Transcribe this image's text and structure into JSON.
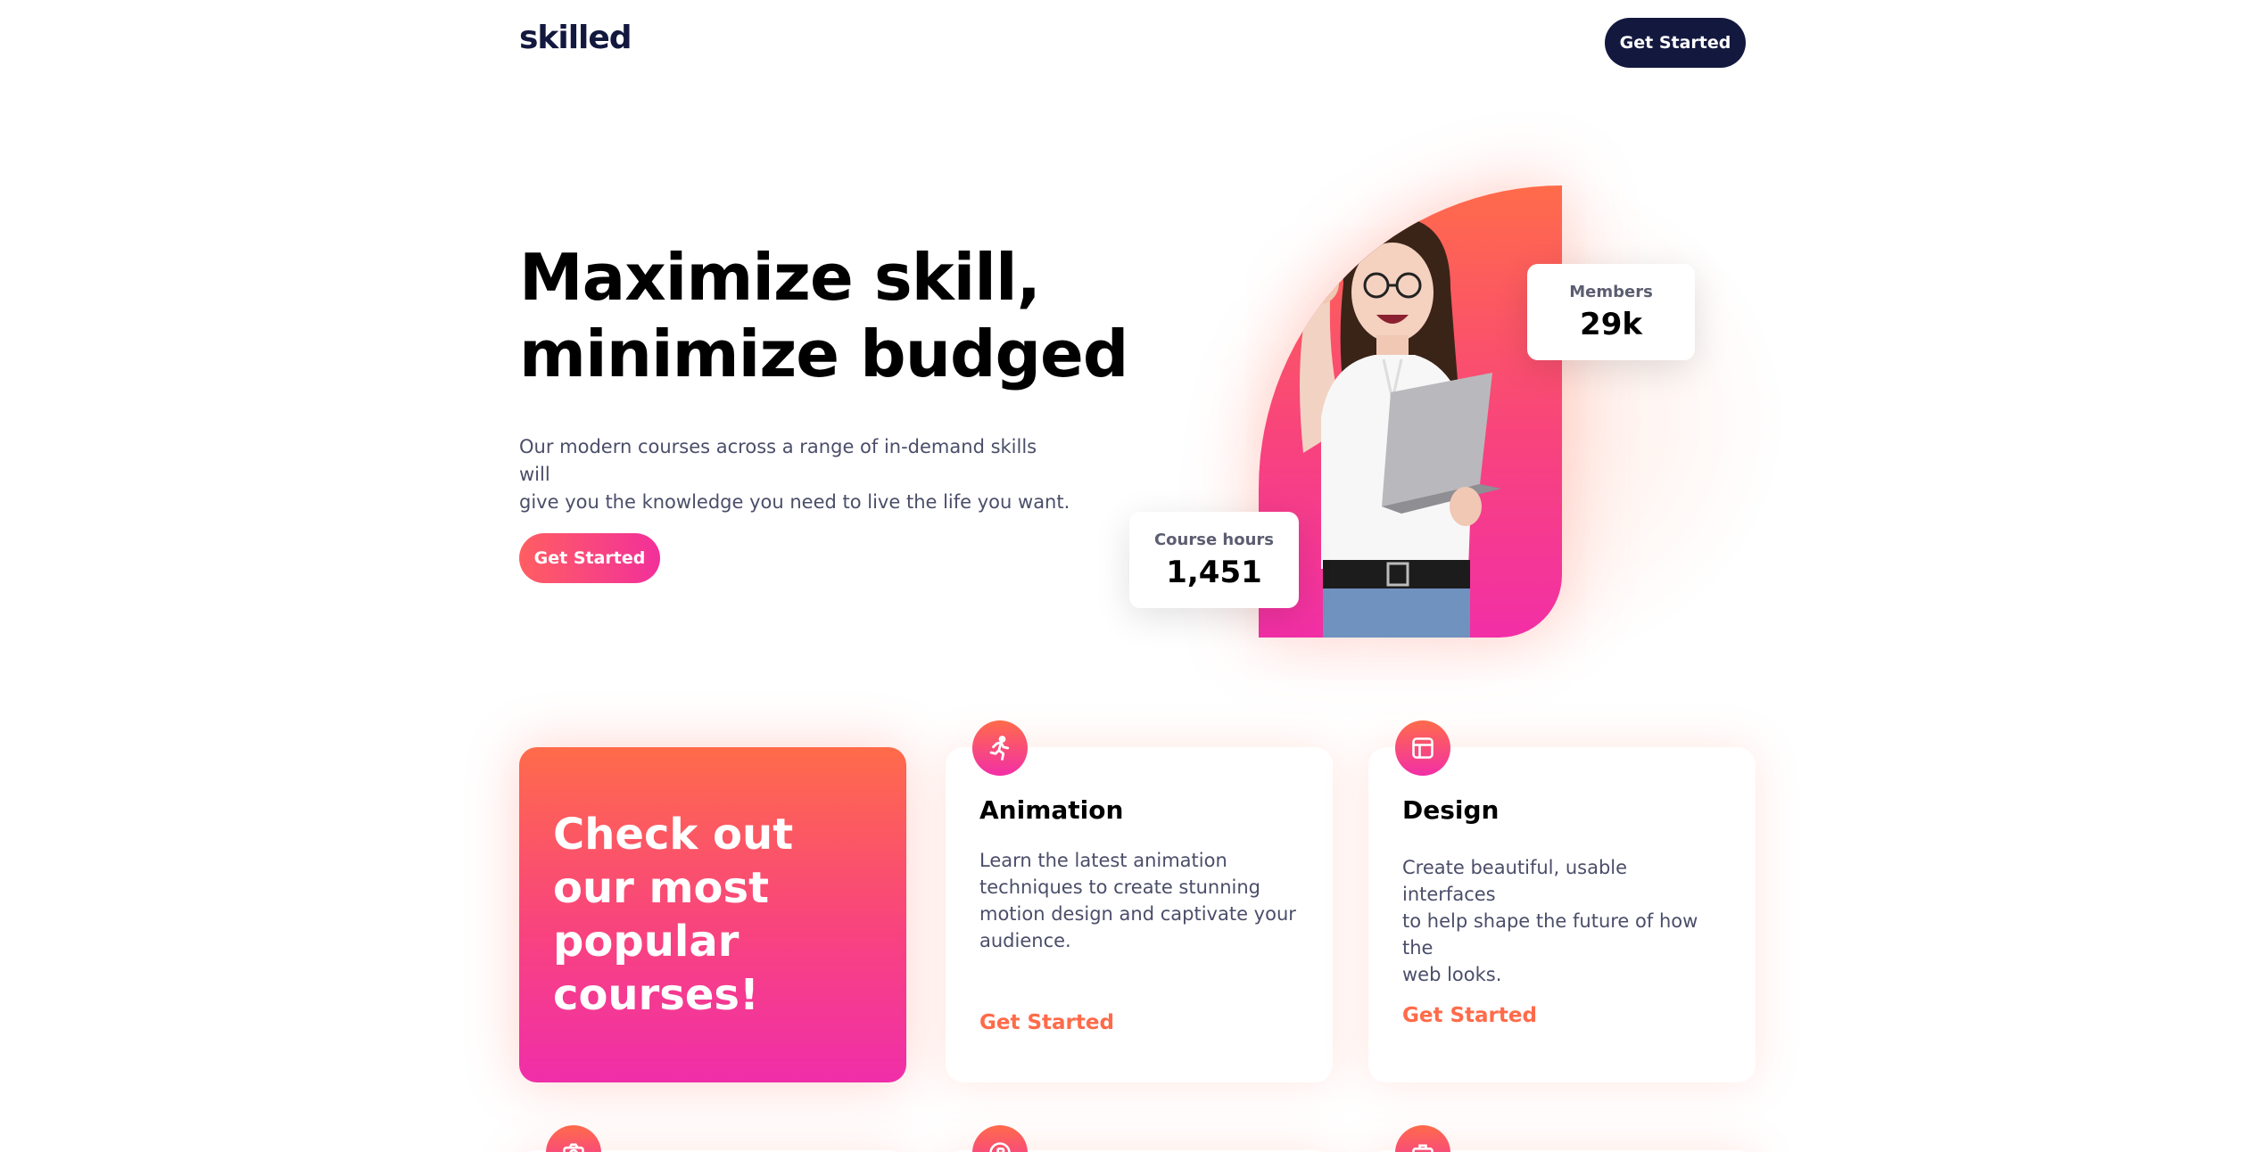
{
  "header": {
    "logo": "skilled",
    "cta_label": "Get Started"
  },
  "hero": {
    "title_line1": "Maximize skill,",
    "title_line2": "minimize budged",
    "subtitle_line1": "Our modern courses across a range of in-demand skills will",
    "subtitle_line2": "give you the knowledge you need to live the life you want.",
    "cta_label": "Get Started",
    "stats": {
      "members": {
        "label": "Members",
        "value": "29k"
      },
      "course_hours": {
        "label": "Course hours",
        "value": "1,451"
      }
    }
  },
  "courses": {
    "promo": {
      "line1": "Check out",
      "line2": "our most",
      "line3": "popular",
      "line4": "courses!"
    },
    "items": [
      {
        "icon": "running-person-icon",
        "title": "Animation",
        "desc_line1": "Learn the latest animation",
        "desc_line2": "techniques to create stunning",
        "desc_line3": "motion design and captivate your",
        "desc_line4": "audience.",
        "link": "Get Started"
      },
      {
        "icon": "layout-icon",
        "title": "Design",
        "desc_line1": "Create beautiful, usable interfaces",
        "desc_line2": "to help shape the future of how the",
        "desc_line3": "web looks.",
        "link": "Get Started"
      }
    ],
    "partial_icons": [
      "camera-icon",
      "crypto-icon",
      "briefcase-icon"
    ]
  },
  "colors": {
    "navy": "#13183f",
    "accent_orange": "#ff6b4a",
    "accent_pink": "#f22fa6"
  }
}
